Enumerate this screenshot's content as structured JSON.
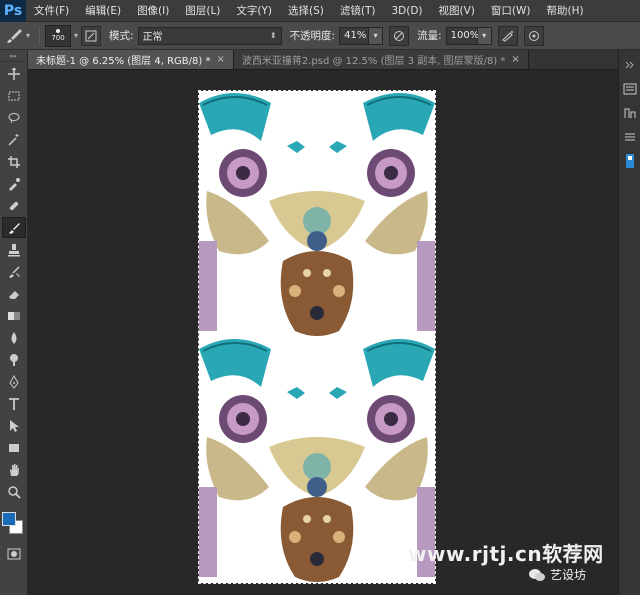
{
  "app": {
    "logo_text": "Ps"
  },
  "menu": [
    "文件(F)",
    "编辑(E)",
    "图像(I)",
    "图层(L)",
    "文字(Y)",
    "选择(S)",
    "滤镜(T)",
    "3D(D)",
    "视图(V)",
    "窗口(W)",
    "帮助(H)"
  ],
  "options_bar": {
    "brush_size": "700",
    "mode_label": "模式:",
    "mode_value": "正常",
    "opacity_label": "不透明度:",
    "opacity_value": "41%",
    "flow_label": "流量:",
    "flow_value": "100%"
  },
  "tabs": [
    {
      "title": "未标题-1 @ 6.25% (图层 4, RGB/8) *",
      "close": "×",
      "active": true
    },
    {
      "title": "波西米亚撞蒋2.psd @ 12.5% (图层 3 副本, 图层蒙版/8) *",
      "close": "×",
      "active": false
    }
  ],
  "tools": [
    "move-icon",
    "marquee-icon",
    "lasso-icon",
    "magic-wand-icon",
    "crop-icon",
    "eyedropper-icon",
    "healing-brush-icon",
    "brush-icon",
    "clone-stamp-icon",
    "history-brush-icon",
    "eraser-icon",
    "gradient-icon",
    "blur-icon",
    "dodge-icon",
    "pen-icon",
    "type-icon",
    "path-selection-icon",
    "rectangle-icon",
    "hand-icon",
    "zoom-icon"
  ],
  "colors": {
    "foreground": "#1b6bb8",
    "background": "#ffffff",
    "teal": "#2aa7b5"
  },
  "watermark": {
    "url": "www.rjtj.cn软荐网",
    "brand": "艺设坊"
  }
}
